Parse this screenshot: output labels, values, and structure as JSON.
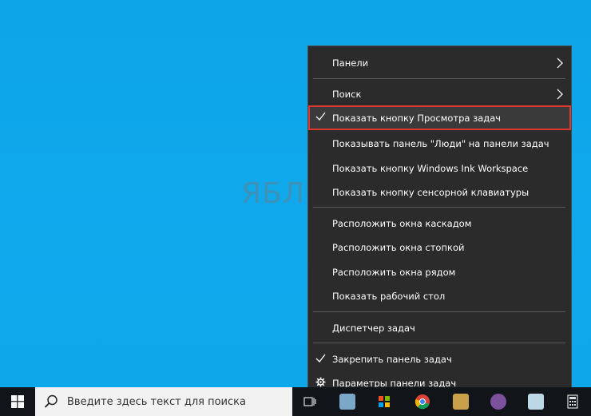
{
  "watermark": "ЯБЛЫК",
  "menu": {
    "items": [
      {
        "label": "Панели",
        "checked": false,
        "submenu": true
      },
      {
        "label": "Поиск",
        "checked": false,
        "submenu": true
      },
      {
        "label": "Показать кнопку Просмотра задач",
        "checked": true,
        "submenu": false,
        "highlighted": true
      },
      {
        "label": "Показывать панель \"Люди\" на панели задач",
        "checked": false,
        "submenu": false
      },
      {
        "label": "Показать кнопку Windows Ink Workspace",
        "checked": false,
        "submenu": false
      },
      {
        "label": "Показать кнопку сенсорной клавиатуры",
        "checked": false,
        "submenu": false
      },
      {
        "label": "Расположить окна каскадом",
        "checked": false,
        "submenu": false
      },
      {
        "label": "Расположить окна стопкой",
        "checked": false,
        "submenu": false
      },
      {
        "label": "Расположить окна рядом",
        "checked": false,
        "submenu": false
      },
      {
        "label": "Показать рабочий стол",
        "checked": false,
        "submenu": false
      },
      {
        "label": "Диспетчер задач",
        "checked": false,
        "submenu": false
      },
      {
        "label": "Закрепить панель задач",
        "checked": true,
        "submenu": false
      },
      {
        "label": "Параметры панели задач",
        "checked": false,
        "submenu": false,
        "icon": "gear-icon"
      }
    ]
  },
  "taskbar": {
    "search_placeholder": "Введите здесь текст для поиска"
  },
  "colors": {
    "desktop": "#0fa6e8",
    "menu_bg": "#2b2b2b",
    "highlight_border": "#e0382f",
    "taskbar": "#111418"
  }
}
